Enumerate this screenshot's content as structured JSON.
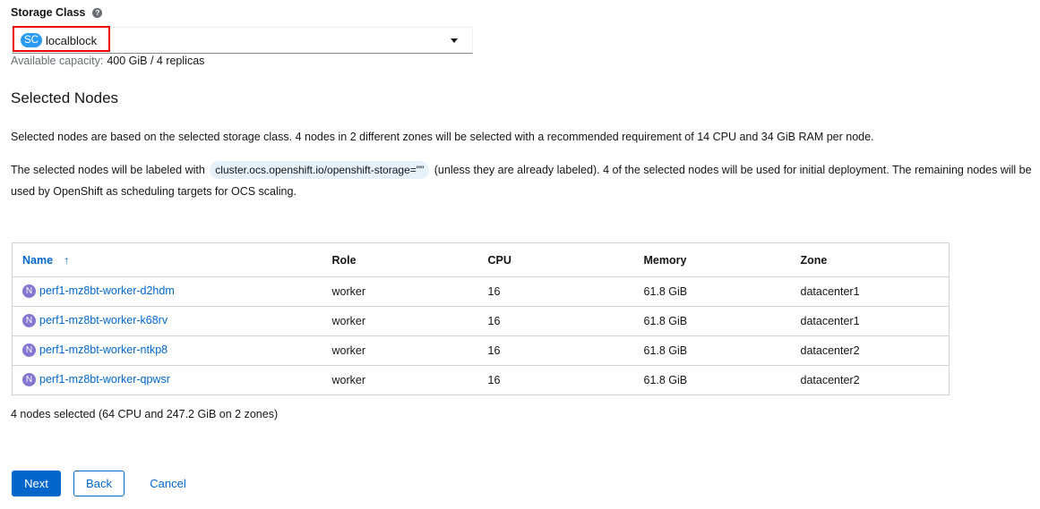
{
  "storage_class": {
    "label": "Storage Class",
    "help_icon": "question-circle-icon",
    "badge": "SC",
    "value": "localblock",
    "capacity_label": "Available capacity:",
    "capacity_value": "400 GiB / 4 replicas"
  },
  "section": {
    "title": "Selected Nodes",
    "para1": "Selected nodes are based on the selected storage class. 4 nodes in 2 different zones will be selected with a recommended requirement of 14 CPU and 34 GiB RAM per node.",
    "para2_before": "The selected nodes will be labeled with",
    "para2_code": "cluster.ocs.openshift.io/openshift-storage=\"\"",
    "para2_after": "(unless they are already labeled). 4 of the selected nodes will be used for initial deployment. The remaining nodes will be used by OpenShift as scheduling targets for OCS scaling."
  },
  "table": {
    "headers": {
      "name": "Name",
      "role": "Role",
      "cpu": "CPU",
      "memory": "Memory",
      "zone": "Zone"
    },
    "sort_icon": "arrow-up-icon",
    "rows": [
      {
        "badge": "N",
        "name": "perf1-mz8bt-worker-d2hdm",
        "role": "worker",
        "cpu": "16",
        "memory": "61.8 GiB",
        "zone": "datacenter1"
      },
      {
        "badge": "N",
        "name": "perf1-mz8bt-worker-k68rv",
        "role": "worker",
        "cpu": "16",
        "memory": "61.8 GiB",
        "zone": "datacenter1"
      },
      {
        "badge": "N",
        "name": "perf1-mz8bt-worker-ntkp8",
        "role": "worker",
        "cpu": "16",
        "memory": "61.8 GiB",
        "zone": "datacenter2"
      },
      {
        "badge": "N",
        "name": "perf1-mz8bt-worker-qpwsr",
        "role": "worker",
        "cpu": "16",
        "memory": "61.8 GiB",
        "zone": "datacenter2"
      }
    ]
  },
  "summary": "4 nodes selected (64 CPU and 247.2 GiB on 2 zones)",
  "buttons": {
    "next": "Next",
    "back": "Back",
    "cancel": "Cancel"
  },
  "colors": {
    "primary": "#0066cc",
    "sc_badge": "#2b9af3",
    "node_badge": "#8476d1",
    "highlight": "#ee0000"
  }
}
